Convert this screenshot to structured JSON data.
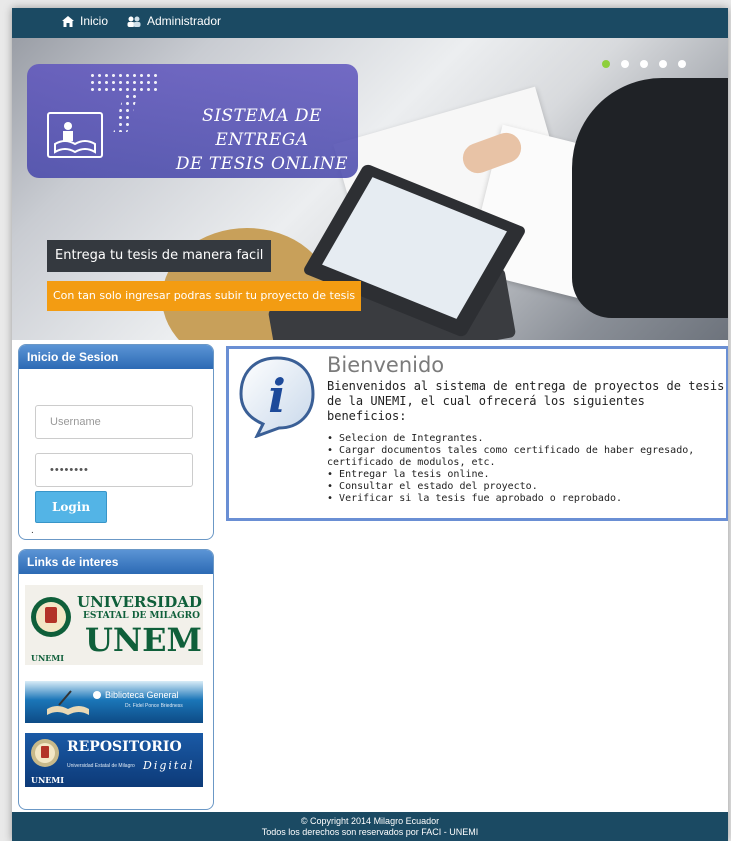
{
  "nav": {
    "items": [
      {
        "label": "Inicio",
        "icon": "home-icon"
      },
      {
        "label": "Administrador",
        "icon": "admin-icon"
      }
    ]
  },
  "hero": {
    "logo_line1": "SISTEMA DE ENTREGA",
    "logo_line2": "DE TESIS ONLINE",
    "caption1": "Entrega tu tesis de manera facil",
    "caption2": "Con tan solo ingresar podras subir tu proyecto de tesis",
    "slides": 5,
    "active_slide": 1
  },
  "login": {
    "title": "Inicio de Sesion",
    "username_placeholder": "Username",
    "password_value": "••••••••",
    "button_label": "Login",
    "note": "."
  },
  "links": {
    "title": "Links de interes",
    "items": [
      {
        "name": "UNIVERSIDAD",
        "line2": "ESTATAL DE MILAGRO",
        "line3": "UNEMI",
        "seal": "UNEMI"
      },
      {
        "name": "Biblioteca General",
        "subtitle": "Dr. Fidel Ponce Briedness"
      },
      {
        "name": "REPOSITORIO",
        "subtitle": "Universidad Estatal de Milagro",
        "tag": "Digital",
        "seal": "UNEMI"
      }
    ]
  },
  "welcome": {
    "title": "Bienvenido",
    "intro": "Bienvenidos al sistema de entrega de proyectos de tesis de la UNEMI, el cual ofrecerá los siguientes beneficios:",
    "benefits": [
      "Selecion de Integrantes.",
      "Cargar documentos tales como certificado de haber egresado, certificado de modulos, etc.",
      "Entregar la tesis online.",
      "Consultar el estado del proyecto.",
      "Verificar si la tesis fue aprobado o reprobado."
    ]
  },
  "footer": {
    "line1": "© Copyright 2014 Milagro Ecuador",
    "line2": "Todos los derechos son reservados por FACI - UNEMI"
  },
  "colors": {
    "nav_bg": "#1b4a63",
    "panel_head": "#2c6ab4",
    "accent_orange": "#f39c12",
    "login_button": "#53b4e6",
    "info_border": "#6a8fd4"
  }
}
